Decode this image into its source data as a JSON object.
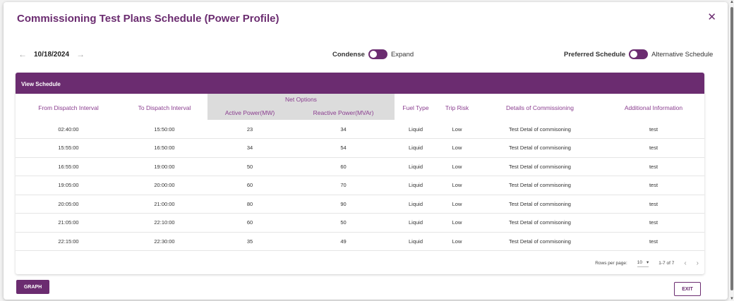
{
  "dialog": {
    "title": "Commissioning Test Plans Schedule (Power Profile)",
    "close_glyph": "✕"
  },
  "date_nav": {
    "prev_glyph": "←",
    "date": "10/18/2024",
    "next_glyph": "→"
  },
  "condense_toggle": {
    "label_left": "Condense",
    "label_right": "Expand"
  },
  "schedule_toggle": {
    "label_left": "Preferred Schedule",
    "label_right": "Alternative Schedule"
  },
  "table": {
    "card_title": "View Schedule",
    "headers": {
      "from": "From Dispatch Interval",
      "to": "To Dispatch Interval",
      "net_options": "Net Options",
      "active": "Active Power(MW)",
      "reactive": "Reactive Power(MVAr)",
      "fuel": "Fuel Type",
      "trip": "Trip Risk",
      "details": "Details of Commissioning",
      "info": "Additional Information"
    },
    "rows": [
      [
        "02:40:00",
        "15:50:00",
        "23",
        "34",
        "Liquid",
        "Low",
        "Test Detal of commisoning",
        "test"
      ],
      [
        "15:55:00",
        "16:50:00",
        "34",
        "54",
        "Liquid",
        "Low",
        "Test Detal of commisoning",
        "test"
      ],
      [
        "16:55:00",
        "19:00:00",
        "50",
        "60",
        "Liquid",
        "Low",
        "Test Detal of commisoning",
        "test"
      ],
      [
        "19:05:00",
        "20:00:00",
        "60",
        "70",
        "Liquid",
        "Low",
        "Test Detal of commisoning",
        "test"
      ],
      [
        "20:05:00",
        "21:00:00",
        "80",
        "90",
        "Liquid",
        "Low",
        "Test Detal of commisoning",
        "test"
      ],
      [
        "21:05:00",
        "22:10:00",
        "60",
        "50",
        "Liquid",
        "Low",
        "Test Detal of commisoning",
        "test"
      ],
      [
        "22:15:00",
        "22:30:00",
        "35",
        "49",
        "Liquid",
        "Low",
        "Test Detal of commisoning",
        "test"
      ]
    ]
  },
  "pagination": {
    "rows_per_page_label": "Rows per page:",
    "rows_per_page_value": "10",
    "range": "1-7 of 7",
    "prev_glyph": "‹",
    "next_glyph": "›"
  },
  "buttons": {
    "graph": "GRAPH",
    "exit": "EXIT"
  },
  "colors": {
    "accent": "#6b2c70",
    "net_options_bg": "#dcdcdc"
  }
}
